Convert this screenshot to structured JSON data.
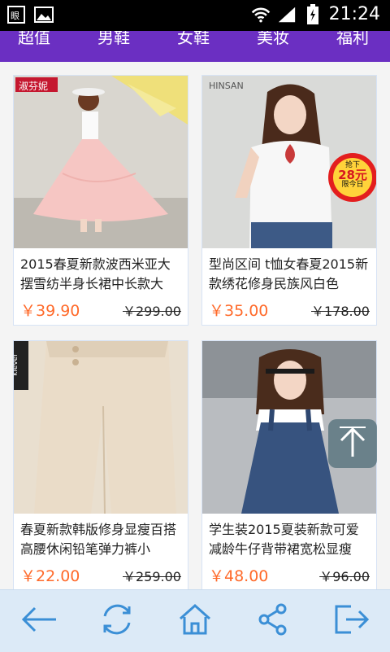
{
  "status_bar": {
    "time": "21:24",
    "left_icons": [
      "notification-icon",
      "image-icon"
    ],
    "right_icons": [
      "wifi-icon",
      "signal-icon",
      "battery-icon"
    ]
  },
  "tabs": [
    "超值",
    "男鞋",
    "女鞋",
    "美妆",
    "福利"
  ],
  "products": [
    {
      "title": "2015春夏新款波西米亚大摆雪纺半身长裙中长款大",
      "price": "￥39.90",
      "original_price": "￥299.00",
      "brand_text": "淑芬妮"
    },
    {
      "title": "型尚区间 t恤女春夏2015新款绣花修身民族风白色",
      "price": "￥35.00",
      "original_price": "￥178.00",
      "brand_text": "HINSAN",
      "badge": {
        "top": "抢下",
        "main": "28元",
        "bottom": "限今日"
      }
    },
    {
      "title": "春夏新款韩版修身显瘦百搭高腰休闲铅笔弹力裤小",
      "price": "￥22.00",
      "original_price": "￥259.00",
      "brand_text": "klever"
    },
    {
      "title": "学生装2015夏装新款可爱减龄牛仔背带裙宽松显瘦",
      "price": "￥48.00",
      "original_price": "￥96.00"
    }
  ],
  "back_to_top_icon": "arrow-up-icon",
  "bottom_nav": [
    "back-arrow-icon",
    "refresh-icon",
    "home-icon",
    "share-icon",
    "exit-icon"
  ],
  "colors": {
    "tab_bar": "#6b2fc2",
    "price": "#ff6a2a",
    "bottom_bar": "#dceaf7",
    "nav_icon": "#3b8fd6"
  }
}
